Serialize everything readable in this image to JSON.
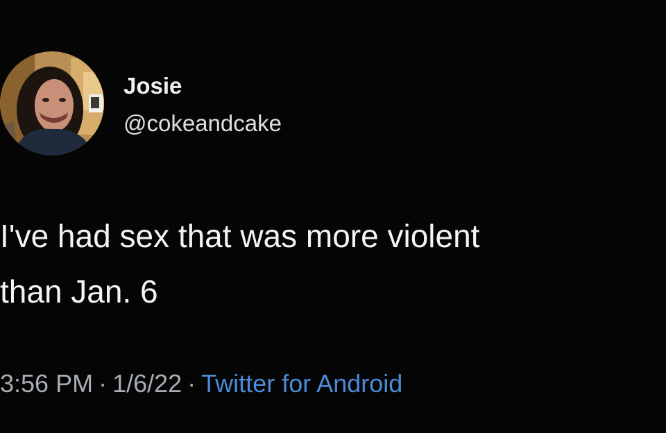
{
  "author": {
    "display_name": "Josie",
    "handle": "@cokeandcake",
    "avatar_icon": "profile-photo"
  },
  "tweet": {
    "text_lines": [
      "I've had sex that was more violent",
      "than Jan. 6"
    ]
  },
  "meta": {
    "time": "3:56 PM",
    "separator": "·",
    "date": "1/6/22",
    "source": "Twitter for Android"
  },
  "colors": {
    "background": "#050505",
    "text": "#f3f4f6",
    "meta_text": "#a7adb3",
    "source_link": "#4a8bd8"
  }
}
